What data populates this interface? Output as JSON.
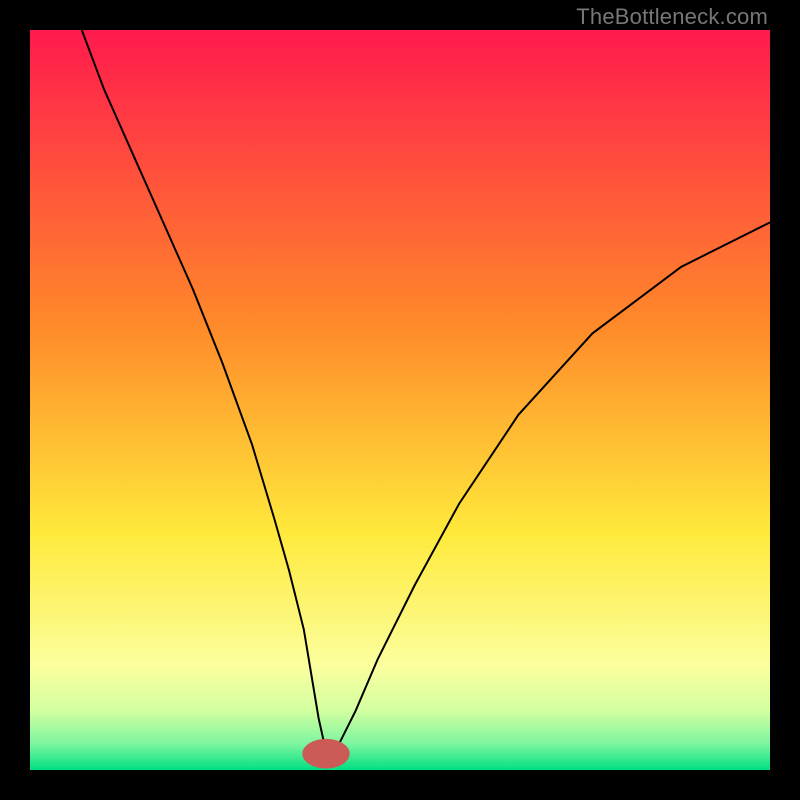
{
  "watermark": "TheBottleneck.com",
  "chart_data": {
    "type": "line",
    "title": "",
    "xlabel": "",
    "ylabel": "",
    "xlim": [
      0,
      100
    ],
    "ylim": [
      0,
      100
    ],
    "grid": false,
    "legend": false,
    "background_gradient": {
      "stops": [
        {
          "offset": 0.0,
          "color": "#ff1a4d"
        },
        {
          "offset": 0.4,
          "color": "#ff8a2a"
        },
        {
          "offset": 0.68,
          "color": "#ffe93b"
        },
        {
          "offset": 0.86,
          "color": "#fbff9e"
        },
        {
          "offset": 0.92,
          "color": "#d2ffa0"
        },
        {
          "offset": 0.965,
          "color": "#7cf5a0"
        },
        {
          "offset": 1.0,
          "color": "#00e082"
        }
      ]
    },
    "marker": {
      "x": 40,
      "y": 2.2,
      "color": "#cc5a56",
      "rx": 3.2,
      "ry": 2.0,
      "note": "small red oval marker at curve minimum"
    },
    "series": [
      {
        "name": "curve",
        "color": "#000000",
        "stroke_width": 2,
        "x": [
          7,
          10,
          14,
          18,
          22,
          26,
          30,
          33,
          35,
          37,
          38,
          39,
          40,
          41,
          42,
          44,
          47,
          52,
          58,
          66,
          76,
          88,
          100
        ],
        "y": [
          100,
          92,
          83,
          74,
          65,
          55,
          44,
          34,
          27,
          19,
          13,
          7,
          2.5,
          2.5,
          4,
          8,
          15,
          25,
          36,
          48,
          59,
          68,
          74
        ]
      }
    ]
  }
}
